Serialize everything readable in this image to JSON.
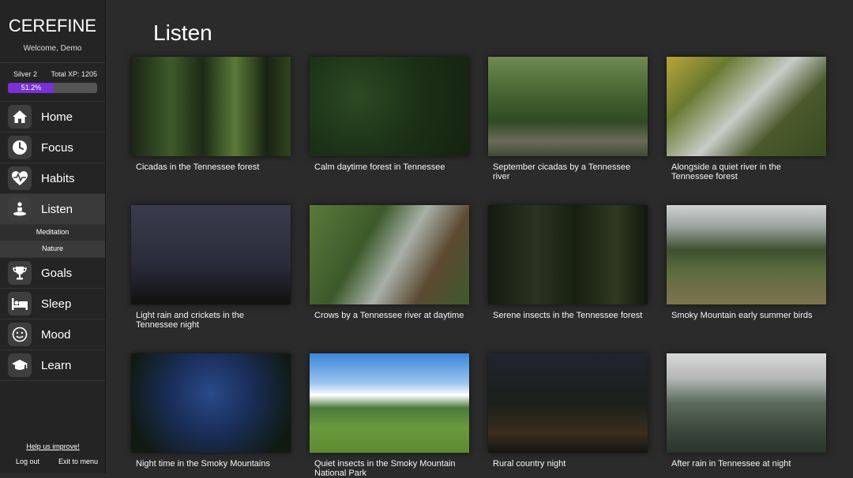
{
  "app": {
    "brand": "CEREFINE",
    "welcome": "Welcome, Demo",
    "rank": "Silver 2",
    "total_xp": "Total XP: 1205",
    "progress_label": "51.2%",
    "progress_fraction": 0.512
  },
  "nav": {
    "home": "Home",
    "focus": "Focus",
    "habits": "Habits",
    "listen": "Listen",
    "meditation": "Meditation",
    "nature": "Nature",
    "goals": "Goals",
    "sleep": "Sleep",
    "mood": "Mood",
    "learn": "Learn"
  },
  "footer": {
    "help": "Help us improve!",
    "logout": "Log out",
    "exit": "Exit to menu"
  },
  "page": {
    "title": "Listen"
  },
  "tracks": [
    "Cicadas in the Tennessee forest",
    "Calm daytime forest in Tennessee",
    "September cicadas by a Tennessee river",
    "Alongside a quiet river in the Tennessee forest",
    "Light rain and crickets in the Tennessee night",
    "Crows by a Tennessee river at daytime",
    "Serene insects in the Tennessee forest",
    "Smoky Mountain early summer birds",
    "Night time in the Smoky Mountains",
    "Quiet insects in the Smoky Mountain National Park",
    "Rural country night",
    "After rain in Tennessee at night"
  ]
}
